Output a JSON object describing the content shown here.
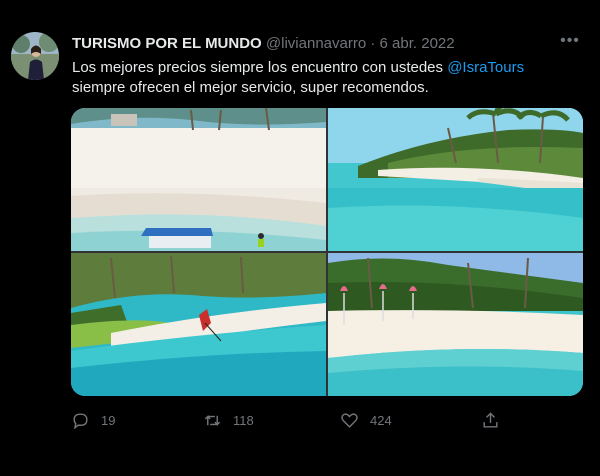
{
  "tweet": {
    "author": "TURISMO POR EL MUNDO",
    "handle": "@liviannavarro",
    "separator": "·",
    "date": "6 abr. 2022",
    "text_part1": "Los mejores precios siempre los encuentro con ustedes ",
    "mention": "@IsraTours",
    "text_part2": "siempre ofrecen el mejor servicio, super recomendos.",
    "more": "•••"
  },
  "actions": {
    "replies": "19",
    "retweets": "118",
    "likes": "424"
  },
  "icons": {
    "avatar": "avatar-photo",
    "more": "more-options-icon",
    "reply": "reply-icon",
    "retweet": "retweet-icon",
    "like": "heart-icon",
    "share": "share-icon"
  },
  "colors": {
    "background": "#000000",
    "text": "#e7e9ea",
    "secondary": "#71767b",
    "accent": "#1d9bf0"
  }
}
